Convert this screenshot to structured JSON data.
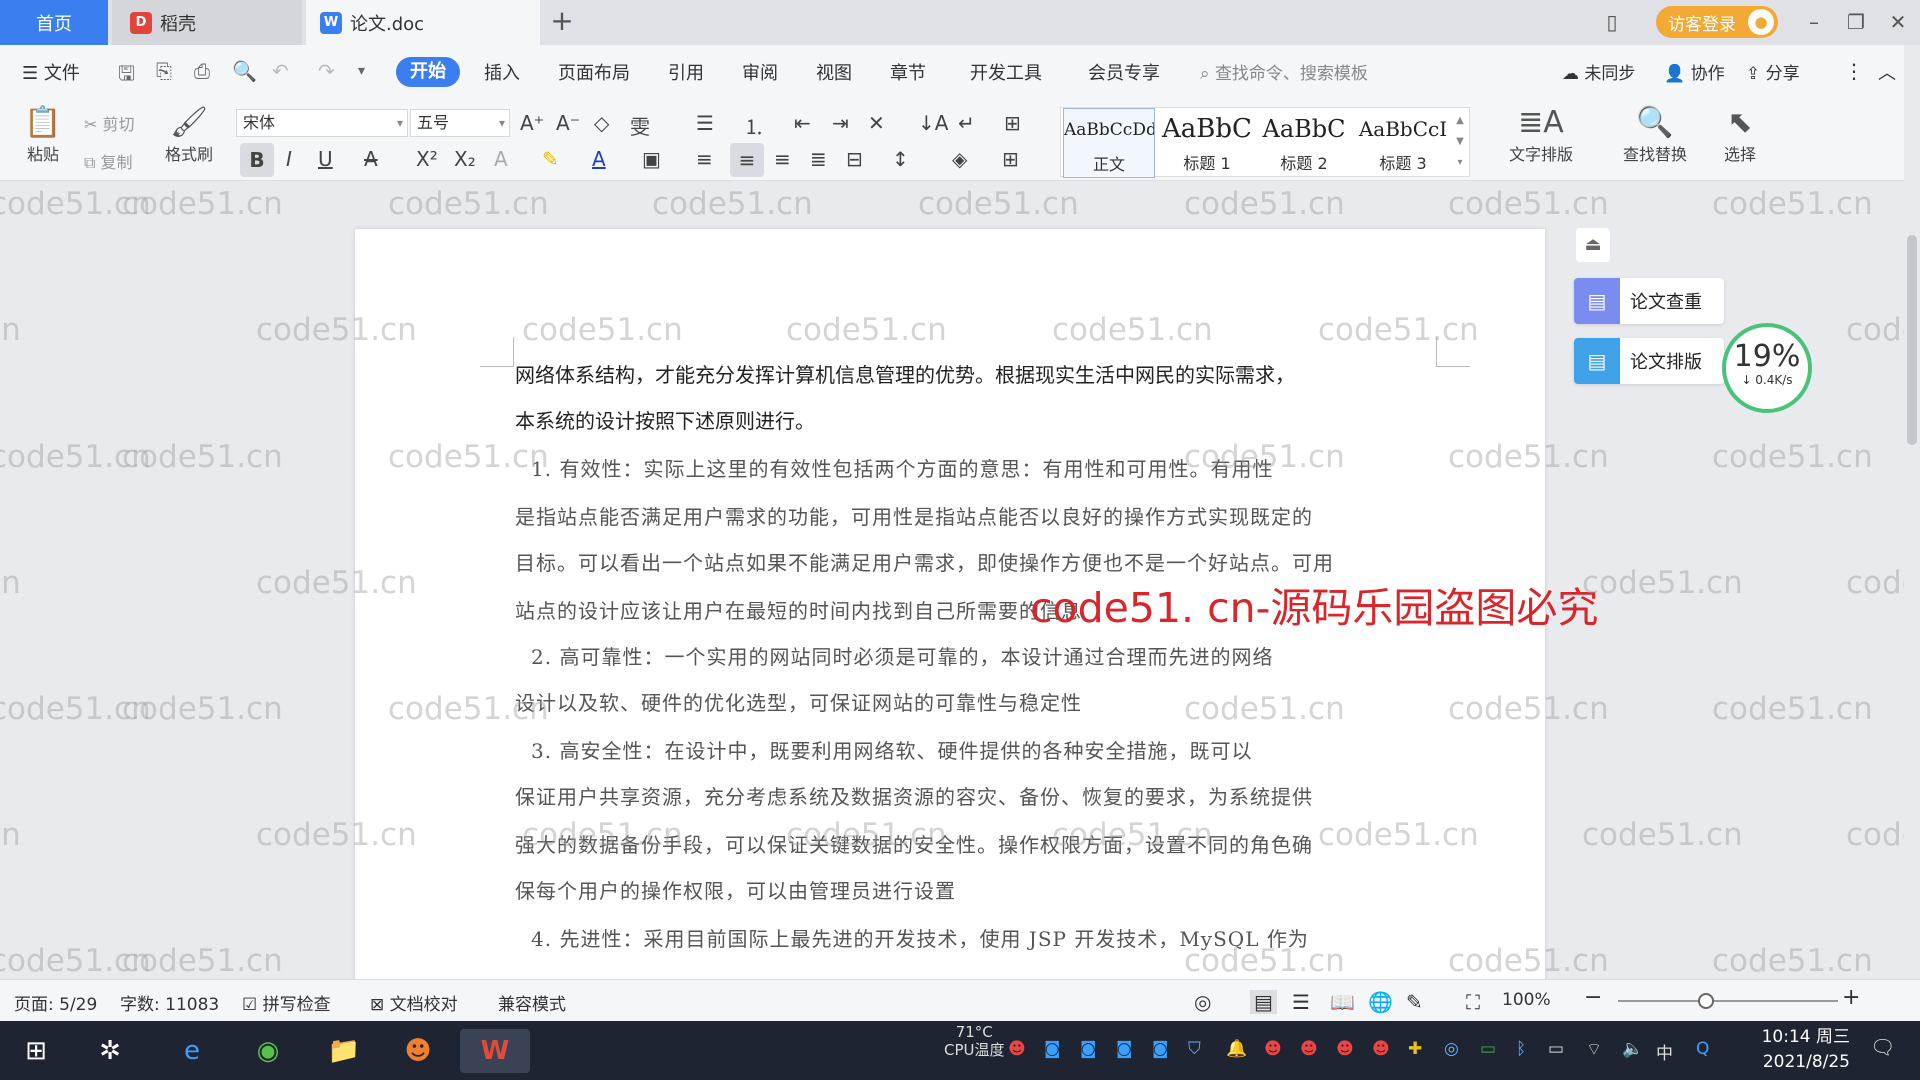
{
  "titlebar": {
    "tab_home": "首页",
    "tab_daoke": "稻壳",
    "tab_doc": "论文.doc",
    "add_tab": "+",
    "visitor_login": "访客登录"
  },
  "menu": {
    "file": "文件",
    "items": [
      "开始",
      "插入",
      "页面布局",
      "引用",
      "审阅",
      "视图",
      "章节",
      "开发工具",
      "会员专享"
    ],
    "search_placeholder": "查找命令、搜索模板",
    "not_synced": "未同步",
    "collaborate": "协作",
    "share": "分享"
  },
  "ribbon": {
    "paste": "粘贴",
    "cut": "剪切",
    "copy": "复制",
    "format_painter": "格式刷",
    "font_name": "宋体",
    "font_size": "五号",
    "styles": [
      {
        "sample": "AaBbCcDd",
        "name": "正文"
      },
      {
        "sample": "AaBbC",
        "name": "标题 1"
      },
      {
        "sample": "AaBbC",
        "name": "标题 2"
      },
      {
        "sample": "AaBbCcI",
        "name": "标题 3"
      }
    ],
    "text_layout": "文字排版",
    "find_replace": "查找替换",
    "select": "选择"
  },
  "document": {
    "paragraphs": [
      "网络体系结构，才能充分发挥计算机信息管理的优势。根据现实生活中网民的实际需求，",
      "本系统的设计按照下述原则进行。",
      "1.      有效性：实际上这里的有效性包括两个方面的意思：有用性和可用性。有用性",
      "是指站点能否满足用户需求的功能，可用性是指站点能否以良好的操作方式实现既定的",
      "目标。可以看出一个站点如果不能满足用户需求，即使操作方便也不是一个好站点。可用",
      "站点的设计应该让用户在最短的时间内找到自己所需要的信息",
      "2.      高可靠性：一个实用的网站同时必须是可靠的，本设计通过合理而先进的网络",
      "设计以及软、硬件的优化选型，可保证网站的可靠性与稳定性",
      "3.      高安全性：在设计中，既要利用网络软、硬件提供的各种安全措施，既可以",
      "保证用户共享资源，充分考虑系统及数据资源的容灾、备份、恢复的要求，为系统提供",
      "强大的数据备份手段，可以保证关键数据的安全性。操作权限方面，设置不同的角色确",
      "保每个用户的操作权限，可以由管理员进行设置",
      "4.      先进性：采用目前国际上最先进的开发技术，使用 JSP 开发技术，MySQL 作为"
    ],
    "watermark_center": "code51. cn-源码乐园盗图必究",
    "watermark": "code51.cn"
  },
  "side": {
    "check": "论文查重",
    "typeset": "论文排版",
    "net_percent": "19%",
    "net_speed": "↓ 0.4K/s"
  },
  "statusbar": {
    "page": "页面: 5/29",
    "words": "字数: 11083",
    "spellcheck": "拼写检查",
    "doc_proof": "文档校对",
    "compat": "兼容模式",
    "zoom": "100%",
    "zoom_level": 0.4
  },
  "taskbar": {
    "temp": "71°C",
    "cpu_label": "CPU温度",
    "ime": "中",
    "time": "10:14 周三",
    "date": "2021/8/25"
  }
}
